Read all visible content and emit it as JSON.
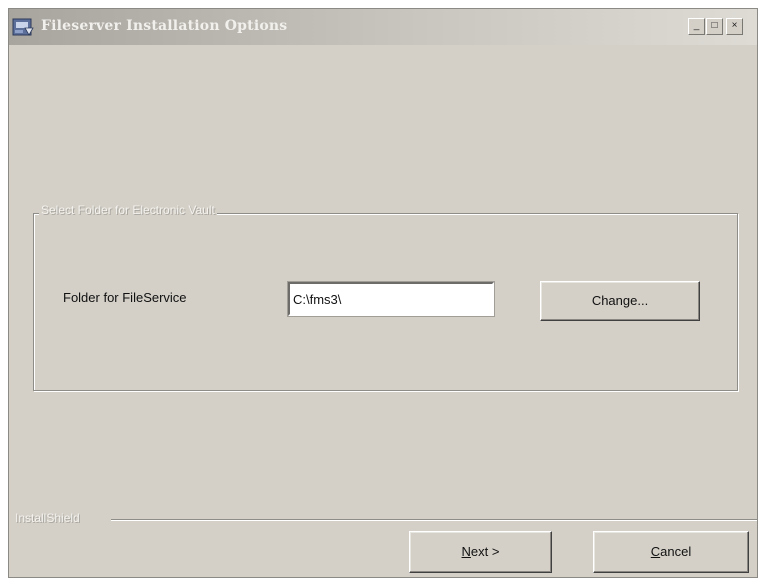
{
  "window": {
    "title": "Fileserver Installation Options",
    "controls": {
      "minimize": "_",
      "maximize": "□",
      "close": "×"
    }
  },
  "group": {
    "legend": "Select Folder for Electronic Vault"
  },
  "folder": {
    "label": "Folder for FileService",
    "value": "C:\\fms3\\"
  },
  "buttons": {
    "change": "Change...",
    "next_accel": "N",
    "next_rest": "ext >",
    "cancel_accel": "C",
    "cancel_rest": "ancel"
  },
  "footer": {
    "brand": "InstallShield"
  },
  "icons": {
    "app": "installer-app-icon",
    "minimize": "minimize-icon",
    "maximize": "maximize-icon",
    "close": "close-icon"
  }
}
